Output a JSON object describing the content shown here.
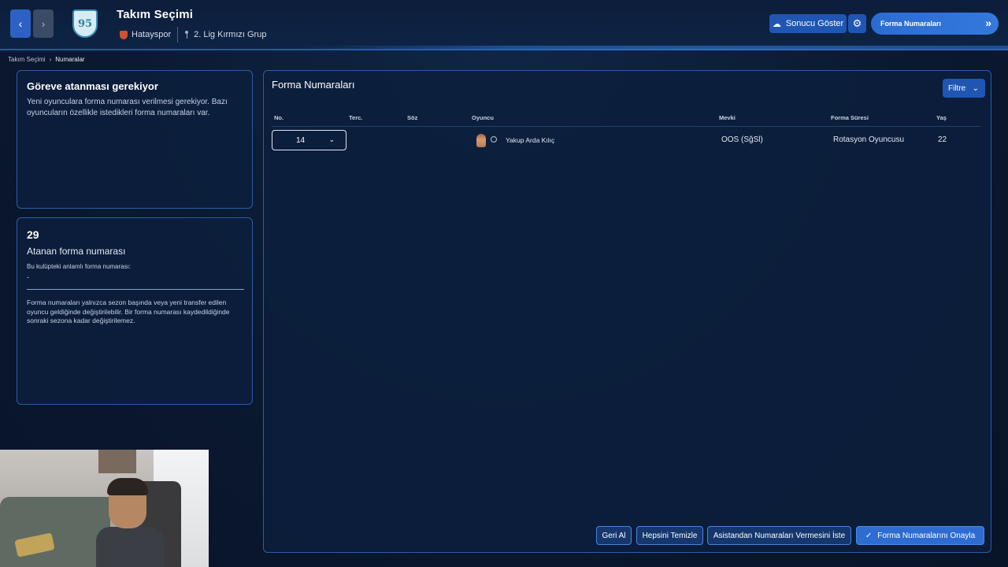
{
  "header": {
    "title": "Takım Seçimi",
    "club_name": "Hatayspor",
    "league": "2. Lig Kırmızı Grup",
    "logo_text": "95",
    "show_result_label": "Sonucu Göster",
    "continue_label": "Forma Numaraları",
    "back_icon": "‹",
    "forward_icon": "›",
    "gear_icon": "⚙",
    "continue_icon": "»"
  },
  "breadcrumb": {
    "parent": "Takım Seçimi",
    "separator": "›",
    "current": "Numaralar"
  },
  "assign_panel": {
    "title": "Göreve atanması gerekiyor",
    "text": "Yeni oyunculara forma numarası verilmesi gerekiyor. Bazı oyuncuların özellikle istedikleri forma numaraları var."
  },
  "stats_panel": {
    "count": "29",
    "count_label": "Atanan forma numarası",
    "meaningful_label": "Bu kulüpteki anlamlı forma numarası:",
    "meaningful_value": "-",
    "note": "Forma numaraları yalnızca sezon başında veya yeni transfer edilen oyuncu geldiğinde değiştirilebilir. Bir forma numarası kaydedildiğinde sonraki sezona kadar değiştirilemez."
  },
  "main": {
    "title": "Forma Numaraları",
    "filter_label": "Filtre",
    "columns": {
      "no": "No.",
      "pref": "Terc.",
      "contract": "Söz",
      "player": "Oyuncu",
      "position": "Mevki",
      "kit_duration": "Forma Süresi",
      "age": "Yaş"
    },
    "rows": [
      {
        "number": "14",
        "player": "Yakup Arda Kılıç",
        "position": "OOS (SğSl)",
        "status": "Rotasyon Oyuncusu",
        "age": "22"
      }
    ],
    "buttons": {
      "undo": "Geri Al",
      "clear_all": "Hepsini Temizle",
      "ask_assistant": "Asistandan Numaraları Vermesini İste",
      "confirm": "Forma Numaralarını Onayla",
      "confirm_icon": "✓"
    }
  }
}
